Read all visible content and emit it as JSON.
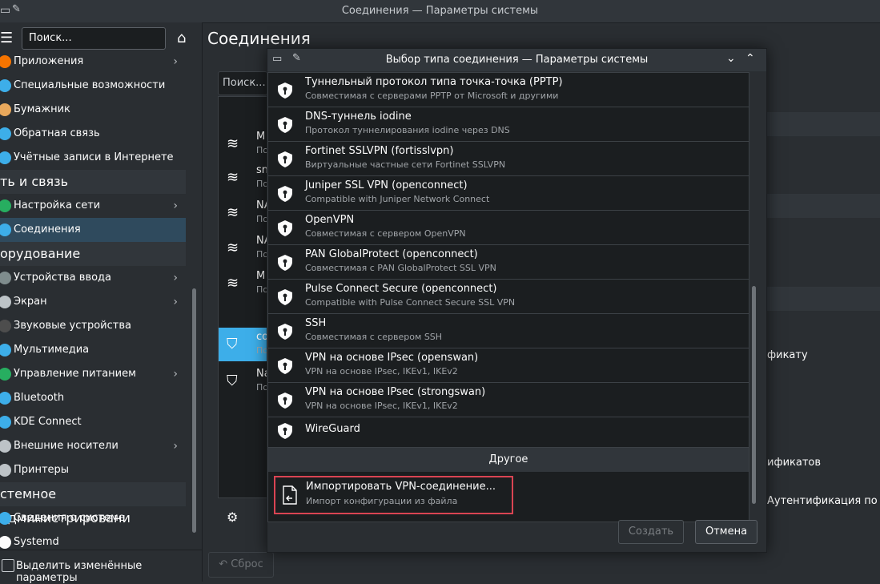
{
  "window": {
    "title": "Соединения — Параметры системы"
  },
  "sidebar": {
    "search_placeholder": "Поиск...",
    "items": [
      {
        "label": "Приложения",
        "chevron": true
      },
      {
        "label": "Специальные возможности",
        "chevron": false
      },
      {
        "label": "Бумажник",
        "chevron": false
      },
      {
        "label": "Обратная связь",
        "chevron": false
      },
      {
        "label": "Учётные записи в Интернете",
        "chevron": false
      },
      {
        "category": "ть и связь"
      },
      {
        "label": "Настройка сети",
        "chevron": true
      },
      {
        "label": "Соединения",
        "chevron": false,
        "active": true
      },
      {
        "category": "орудование"
      },
      {
        "label": "Устройства ввода",
        "chevron": true
      },
      {
        "label": "Экран",
        "chevron": true
      },
      {
        "label": "Звуковые устройства",
        "chevron": false
      },
      {
        "label": "Мультимедиа",
        "chevron": false
      },
      {
        "label": "Управление питанием",
        "chevron": true
      },
      {
        "label": "Bluetooth",
        "chevron": false
      },
      {
        "label": "KDE Connect",
        "chevron": false
      },
      {
        "label": "Внешние носители",
        "chevron": true
      },
      {
        "label": "Принтеры",
        "chevron": false
      },
      {
        "category": "стемное администрировани"
      },
      {
        "label": "Сведения о системе",
        "chevron": false
      },
      {
        "label": "Systemd",
        "chevron": false
      }
    ],
    "highlight_changes_label": "Выделить изменённые параметры"
  },
  "main": {
    "title": "Соединения",
    "search_placeholder": "Поиск...",
    "reset_label": "Сброс",
    "conn_stubs": [
      "M",
      "sn",
      "NA",
      "NA",
      "M",
      "co",
      "Na"
    ],
    "conn_sub": "По",
    "right_texts": [
      "фикату",
      "ификатов",
      "Аутентификация по кл"
    ]
  },
  "dialog": {
    "title": "Выбор типа соединения — Параметры системы",
    "items": [
      {
        "title": "Туннельный протокол типа точка-точка (PPTP)",
        "subtitle": "Совместимая с серверами PPTP от Microsoft и другими"
      },
      {
        "title": "DNS-туннель iodine",
        "subtitle": "Протокол туннелирования iodine через DNS"
      },
      {
        "title": "Fortinet SSLVPN (fortisslvpn)",
        "subtitle": "Виртуальные частные сети Fortinet SSLVPN"
      },
      {
        "title": "Juniper SSL VPN (openconnect)",
        "subtitle": "Compatible with Juniper Network Connect"
      },
      {
        "title": "OpenVPN",
        "subtitle": "Совместимая с сервером OpenVPN"
      },
      {
        "title": "PAN GlobalProtect (openconnect)",
        "subtitle": "Совместимая с PAN GlobalProtect SSL VPN"
      },
      {
        "title": "Pulse Connect Secure (openconnect)",
        "subtitle": "Compatible with Pulse Connect Secure SSL VPN"
      },
      {
        "title": "SSH",
        "subtitle": "Совместимая с сервером SSH"
      },
      {
        "title": "VPN на основе IPsec (openswan)",
        "subtitle": "VPN на основе IPsec, IKEv1, IKEv2"
      },
      {
        "title": "VPN на основе IPsec (strongswan)",
        "subtitle": "VPN на основе IPsec, IKEv1, IKEv2"
      },
      {
        "title": "WireGuard",
        "subtitle": ""
      }
    ],
    "other_header": "Другое",
    "import": {
      "title": "Импортировать VPN-соединение...",
      "subtitle": "Импорт конфигурации из файла"
    },
    "create_label": "Создать",
    "cancel_label": "Отмена"
  },
  "colors": {
    "accent": "#3daee9",
    "highlight_border": "#da4453",
    "background": "#2a2e32"
  }
}
